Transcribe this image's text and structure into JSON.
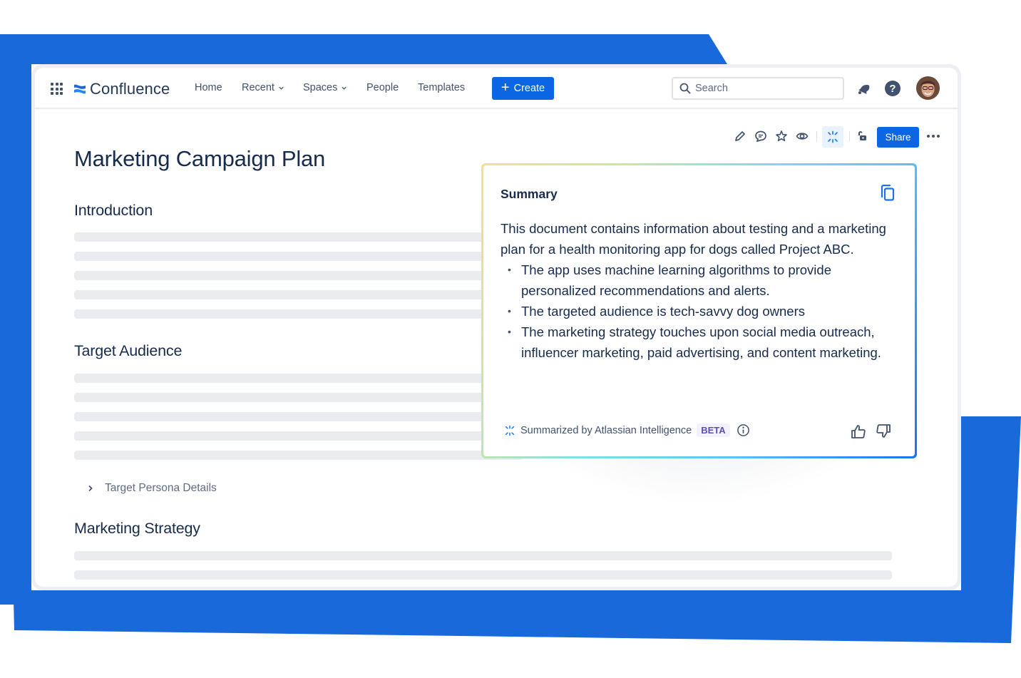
{
  "colors": {
    "brand_blue": "#1a69db",
    "primary_button": "#0c66e4",
    "text_dark": "#172b4d",
    "text_subtle": "#42526e",
    "skeleton": "#ebecf0",
    "beta_bg": "#f3f0ff",
    "beta_text": "#5e4db2"
  },
  "topnav": {
    "app_switcher_icon": "grid-icon",
    "logo_text": "Confluence",
    "items": [
      {
        "label": "Home",
        "has_dropdown": false
      },
      {
        "label": "Recent",
        "has_dropdown": true
      },
      {
        "label": "Spaces",
        "has_dropdown": true
      },
      {
        "label": "People",
        "has_dropdown": false
      },
      {
        "label": "Templates",
        "has_dropdown": false
      }
    ],
    "create_label": "Create",
    "search_placeholder": "Search",
    "notifications_icon": "bell-icon",
    "help_icon": "question-icon",
    "help_glyph": "?"
  },
  "page_toolbar": {
    "icons": [
      "pencil-icon",
      "comment-icon",
      "star-icon",
      "eye-icon",
      "atlassian-intelligence-icon",
      "unlock-icon"
    ],
    "share_label": "Share",
    "more_icon": "ellipsis-icon"
  },
  "document": {
    "title": "Marketing Campaign Plan",
    "sections": [
      {
        "heading": "Introduction"
      },
      {
        "heading": "Target Audience"
      },
      {
        "heading": "Marketing Strategy"
      }
    ],
    "expand_label": "Target Persona Details"
  },
  "summary": {
    "title": "Summary",
    "intro": "This document contains information about testing and a marketing plan for a health monitoring app for dogs called Project ABC.",
    "bullets": [
      "The app uses machine learning algorithms to provide personalized recommendations and alerts.",
      "The targeted audience is tech-savvy dog owners",
      "The marketing strategy touches upon social media outreach, influencer marketing, paid advertising, and content marketing."
    ],
    "footer_text": "Summarized by Atlassian Intelligence",
    "badge": "BETA"
  }
}
